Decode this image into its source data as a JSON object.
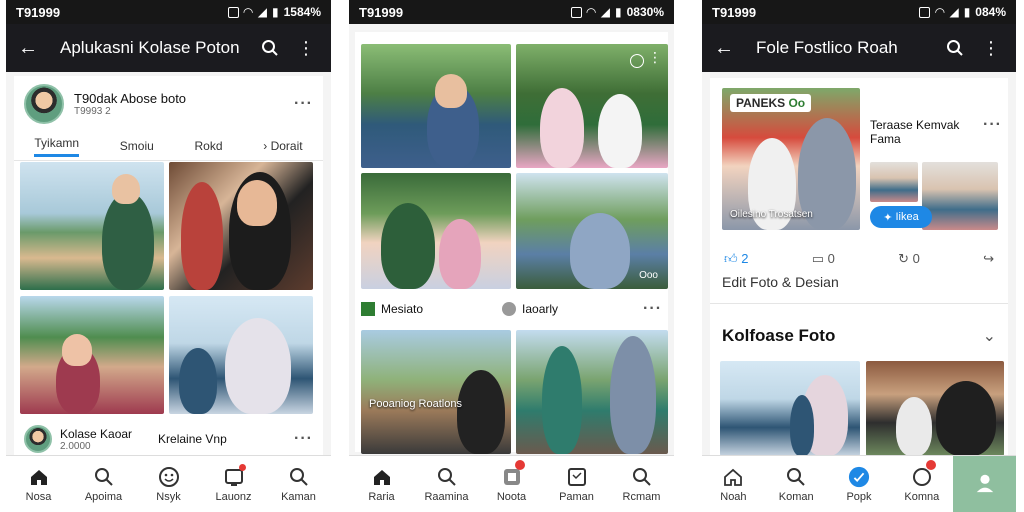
{
  "screen1": {
    "status_time": "T91999",
    "status_right": "1584%",
    "title": "Aplukasni Kolase Poton",
    "profile_name": "T90dak Abose boto",
    "profile_sub": "T9993 2",
    "tabs": [
      "Tyikamn",
      "Smoiu",
      "Rokd",
      "Dorait"
    ],
    "footer_name1": "Kolase Kaoar",
    "footer_sub1": "2.0000",
    "footer_name2": "Krelaine Vnp",
    "nav": [
      "Nosa",
      "Apoima",
      "Nsyk",
      "Lauonz",
      "Kaman"
    ]
  },
  "screen2": {
    "status_time": "T91999",
    "status_right": "0830%",
    "label_left": "Mesiato",
    "label_right": "Iaoarly",
    "overlay_text": "Pooaniog Roatlons",
    "overlay_small": "Ooo",
    "nav": [
      "Raria",
      "Raamina",
      "Noota",
      "Paman",
      "Rcmam"
    ]
  },
  "screen3": {
    "status_time": "T91999",
    "status_right": "084%",
    "title": "Fole Fostlico Roah",
    "banner_tag": "PANEKS",
    "banner_tag_badge": "Oo",
    "post_title": "Teraase Kemvak",
    "post_sub": "Fama",
    "post_caption": "Oilesino Trosatsen",
    "share_label": "Iikea",
    "like_count": "2",
    "comment_count": "0",
    "share_count": "0",
    "edit_label": "Edit Foto & Desian",
    "section_title": "Kolfoase Foto",
    "nav": [
      "Noah",
      "Koman",
      "Popk",
      "Komna",
      ""
    ]
  },
  "colors": {
    "accent": "#1e88e5",
    "appbar": "#1b1b1f",
    "badge": "#e53935"
  }
}
